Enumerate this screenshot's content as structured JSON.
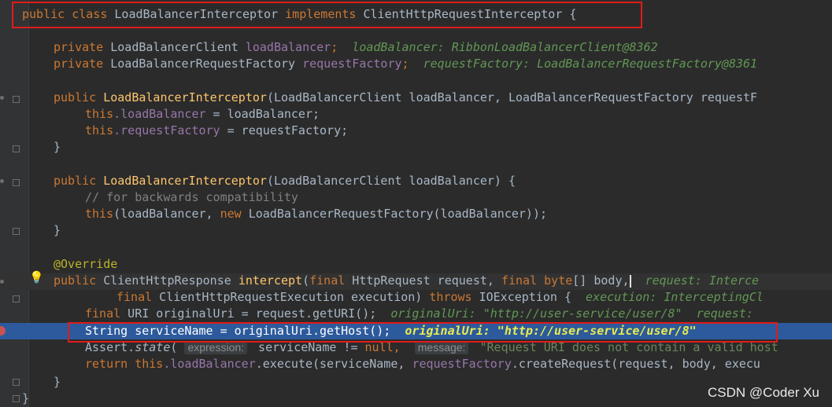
{
  "class_decl": {
    "public": "public",
    "class": "class",
    "name": "LoadBalancerInterceptor",
    "implements": "implements",
    "iface": "ClientHttpRequestInterceptor",
    "brace": " {"
  },
  "fields": [
    {
      "mod": "private",
      "type": "LoadBalancerClient",
      "name": "loadBalancer",
      "semi": ";",
      "hint": "loadBalancer: RibbonLoadBalancerClient@8362"
    },
    {
      "mod": "private",
      "type": "LoadBalancerRequestFactory",
      "name": "requestFactory",
      "semi": ";",
      "hint": "requestFactory: LoadBalancerRequestFactory@8361"
    }
  ],
  "ctor1": {
    "mod": "public",
    "name": "LoadBalancerInterceptor",
    "params": "(LoadBalancerClient loadBalancer, LoadBalancerRequestFactory requestF",
    "line1": {
      "this": "this",
      "field": ".loadBalancer",
      "rest": " = loadBalancer;"
    },
    "line2": {
      "this": "this",
      "field": ".requestFactory",
      "rest": " = requestFactory;"
    },
    "close": "}"
  },
  "ctor2": {
    "mod": "public",
    "name": "LoadBalancerInterceptor",
    "params": "(LoadBalancerClient loadBalancer) {",
    "comment": "// for backwards compatibility",
    "body_this": "this",
    "body_a": "(loadBalancer, ",
    "body_new": "new",
    "body_b": " LoadBalancerRequestFactory(loadBalancer));",
    "close": "}"
  },
  "method": {
    "annotation": "@Override",
    "mod": "public",
    "ret": " ClientHttpResponse ",
    "name": "intercept",
    "p_open": "(",
    "final1": "final",
    "p1": " HttpRequest request, ",
    "final2": "final",
    "byte": " byte",
    "p2": "[] body,",
    "hint1": "request: Interce",
    "final3": "final",
    "p3": " ClientHttpRequestExecution execution) ",
    "throws": "throws",
    "p4": " IOException { ",
    "hint2": "execution: InterceptingCl",
    "l1_final": "final",
    "l1_code": " URI originalUri = request.getURI();",
    "l1_hint": "originalUri: \"http://user-service/user/8\"  request: ",
    "l2_code": "String serviceName = originalUri.getHost();",
    "l2_hint": "originalUri: \"http://user-service/user/8\"",
    "l3_a": "Assert.",
    "l3_state": "state",
    "l3_b": "(",
    "l3_p1": "expression:",
    "l3_c": " serviceName != ",
    "l3_null": "null",
    "l3_d": ", ",
    "l3_p2": "message:",
    "l3_str": " \"Request URI does not contain a valid host",
    "l4_return": "return",
    "l4_this": " this",
    "l4_field": ".loadBalancer",
    "l4_a": ".execute(serviceName, ",
    "l4_field2": "requestFactory",
    "l4_b": ".createRequest(request, body, execu",
    "close": "}"
  },
  "class_close": "}",
  "watermark": "CSDN @Coder Xu",
  "colors": {
    "bg": "#2b2b2b",
    "keyword": "#cc7832",
    "field": "#9876aa",
    "method": "#ffc66d",
    "comment": "#808080",
    "hint": "#629755",
    "highlight": "#2d5a9c",
    "box": "#e01b1b"
  }
}
